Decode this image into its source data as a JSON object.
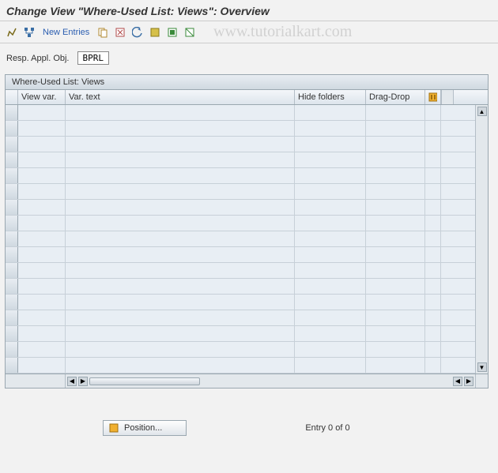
{
  "title": "Change View \"Where-Used List: Views\": Overview",
  "watermark": "www.tutorialkart.com",
  "toolbar": {
    "new_entries": "New Entries"
  },
  "field": {
    "label": "Resp. Appl. Obj.",
    "value": "BPRL"
  },
  "grid": {
    "title": "Where-Used List: Views",
    "cols": {
      "view": "View var.",
      "text": "Var. text",
      "hide": "Hide folders",
      "drag": "Drag-Drop"
    },
    "rows": 17
  },
  "footer": {
    "position": "Position...",
    "entry": "Entry 0 of 0"
  }
}
